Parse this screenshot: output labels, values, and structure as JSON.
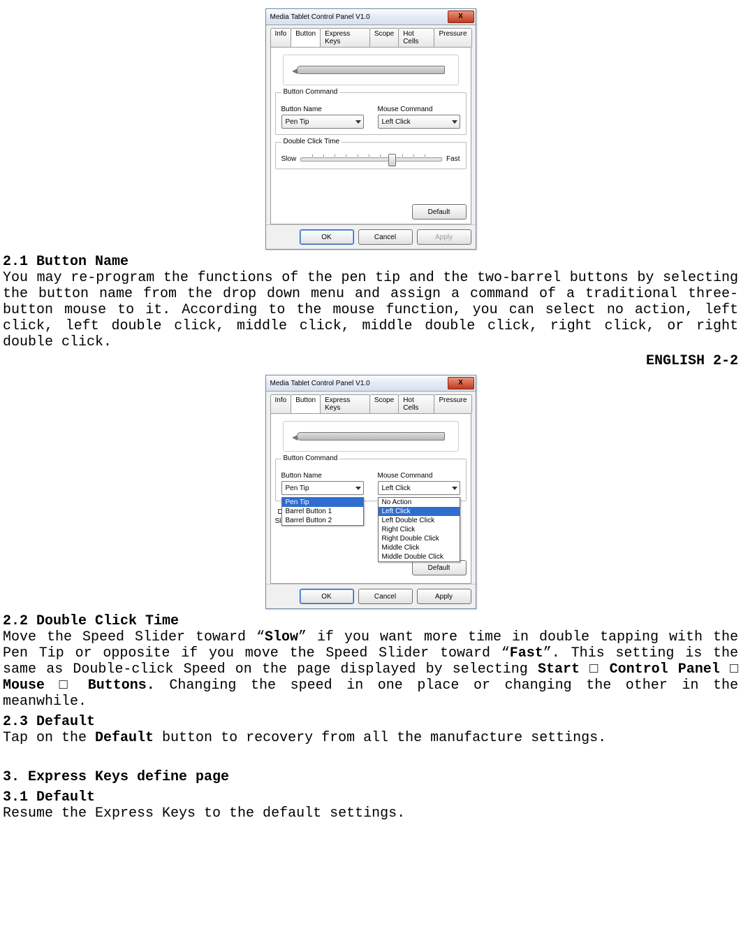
{
  "dialog": {
    "title": "Media Tablet Control Panel V1.0",
    "close_label": "X",
    "tabs": [
      "Info",
      "Button",
      "Express Keys",
      "Scope",
      "Hot Cells",
      "Pressure"
    ],
    "button_command_title": "Button Command",
    "button_name_label": "Button Name",
    "mouse_command_label": "Mouse Command",
    "button_name_value": "Pen Tip",
    "mouse_command_value": "Left Click",
    "button_name_options": [
      "Pen Tip",
      "Barrel Button 1",
      "Barrel Button 2"
    ],
    "mouse_command_options": [
      "No Action",
      "Left Click",
      "Left Double Click",
      "Right Click",
      "Right Double Click",
      "Middle Click",
      "Middle Double Click"
    ],
    "double_click_title": "Double Click Time",
    "slow_label": "Slow",
    "fast_label": "Fast",
    "default_label": "Default",
    "ok_label": "OK",
    "cancel_label": "Cancel",
    "apply_label": "Apply"
  },
  "doc": {
    "h21": "2.1 Button Name",
    "p21": "You may re-program the functions of the pen tip and the two-barrel buttons by selecting the button name from the drop down menu and assign a command of a traditional three-button mouse to it. According to the mouse function, you can select no action, left click, left double click, middle click, middle double click, right click, or right double click.",
    "page_label": "ENGLISH 2-2",
    "h22": "2.2 Double Click Time",
    "p22_pre": "Move the Speed Slider toward “",
    "p22_slow": "Slow",
    "p22_mid1": "” if you want more time in double tapping with the Pen Tip or opposite if you move the Speed Slider toward “",
    "p22_fast": "Fast",
    "p22_mid2": "”. This setting is the same as Double-click Speed on the page displayed by selecting ",
    "p22_start": "Start",
    "p22_a1": " □ ",
    "p22_cp": "Control Panel",
    "p22_a2": " □ ",
    "p22_mouse": "Mouse",
    "p22_a3": " □ ",
    "p22_buttons": "Buttons.",
    "p22_tail": " Changing the speed in one place or changing the other in the meanwhile.",
    "h23": "2.3 Default",
    "p23_pre": "Tap on the ",
    "p23_default": "Default",
    "p23_post": " button to recovery from all the manufacture settings.",
    "h3": "3. Express Keys define page",
    "h31": "3.1 Default",
    "p31": "Resume the Express Keys to the default settings."
  }
}
